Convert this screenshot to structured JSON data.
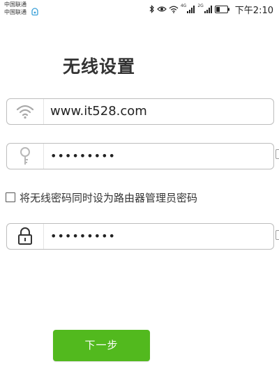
{
  "status_bar": {
    "carrier_1": "中国联通",
    "carrier_2": "中国联通",
    "net_1": "4G",
    "net_2": "2G",
    "time": "下午2:10",
    "icons": [
      "hd-icon",
      "bluetooth-icon",
      "eye-icon",
      "wifi-icon",
      "signal-icon",
      "signal-icon",
      "battery-icon"
    ]
  },
  "title": "无线设置",
  "ssid": {
    "value": "www.it528.com",
    "icon": "wifi-icon"
  },
  "wifi_password": {
    "value": "•••••••••",
    "icon": "key-icon"
  },
  "checkbox": {
    "label": "将无线密码同时设为路由器管理员密码",
    "checked": false
  },
  "admin_password": {
    "value": "•••••••••",
    "icon": "lock-icon"
  },
  "next_button": {
    "label": "下一步"
  },
  "colors": {
    "accent": "#52b91e",
    "border": "#bdbdbd",
    "text": "#333333"
  }
}
